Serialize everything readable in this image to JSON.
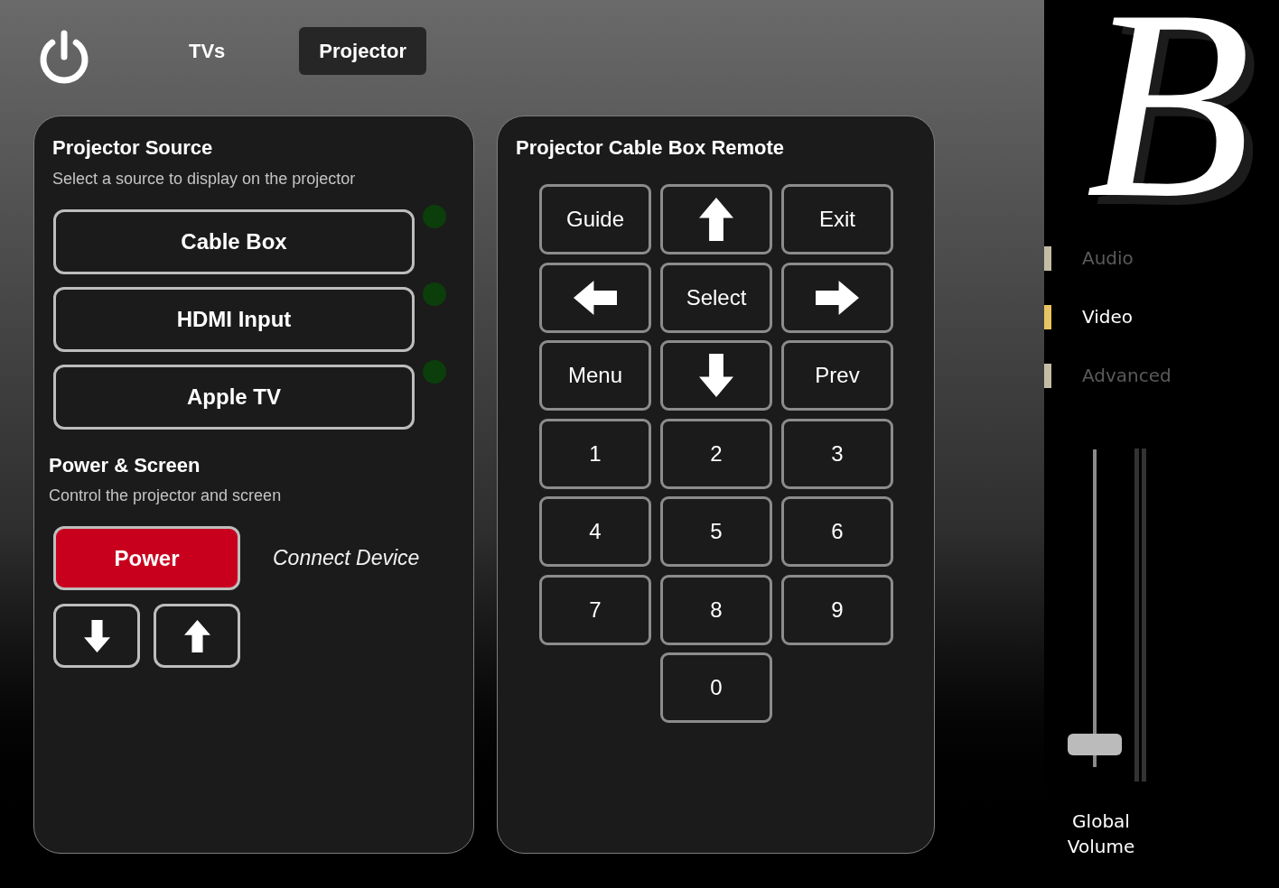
{
  "header": {
    "tabs": [
      {
        "label": "TVs",
        "selected": false
      },
      {
        "label": "Projector",
        "selected": true
      }
    ]
  },
  "source_panel": {
    "title": "Projector Source",
    "subtitle": "Select a source to display on the projector",
    "sources": [
      {
        "label": "Cable Box",
        "active": false
      },
      {
        "label": "HDMI Input",
        "active": false
      },
      {
        "label": "Apple TV",
        "active": false
      }
    ],
    "power_section": {
      "title": "Power & Screen",
      "subtitle": "Control the projector and screen",
      "power_button": {
        "label": "Power"
      },
      "connect_label": "Connect Device",
      "screen_buttons": [
        {
          "kind": "down"
        },
        {
          "kind": "up"
        }
      ]
    }
  },
  "remote_panel": {
    "title": "Projector Cable Box Remote",
    "keys": [
      [
        {
          "kind": "text",
          "label": "Guide"
        },
        {
          "kind": "up"
        },
        {
          "kind": "text",
          "label": "Exit"
        }
      ],
      [
        {
          "kind": "left"
        },
        {
          "kind": "text",
          "label": "Select"
        },
        {
          "kind": "right"
        }
      ],
      [
        {
          "kind": "text",
          "label": "Menu"
        },
        {
          "kind": "down"
        },
        {
          "kind": "text",
          "label": "Prev"
        }
      ],
      [
        {
          "kind": "text",
          "label": "1"
        },
        {
          "kind": "text",
          "label": "2"
        },
        {
          "kind": "text",
          "label": "3"
        }
      ],
      [
        {
          "kind": "text",
          "label": "4"
        },
        {
          "kind": "text",
          "label": "5"
        },
        {
          "kind": "text",
          "label": "6"
        }
      ],
      [
        {
          "kind": "text",
          "label": "7"
        },
        {
          "kind": "text",
          "label": "8"
        },
        {
          "kind": "text",
          "label": "9"
        }
      ],
      [
        {
          "kind": "text",
          "label": "0"
        }
      ]
    ]
  },
  "sidebar": {
    "logo": {
      "text": "B"
    },
    "nav": [
      {
        "label": "Audio",
        "selected": false
      },
      {
        "label": "Video",
        "selected": true
      },
      {
        "label": "Advanced",
        "selected": false
      }
    ],
    "volume": {
      "label": "Global Volume",
      "level": 0.07
    }
  }
}
